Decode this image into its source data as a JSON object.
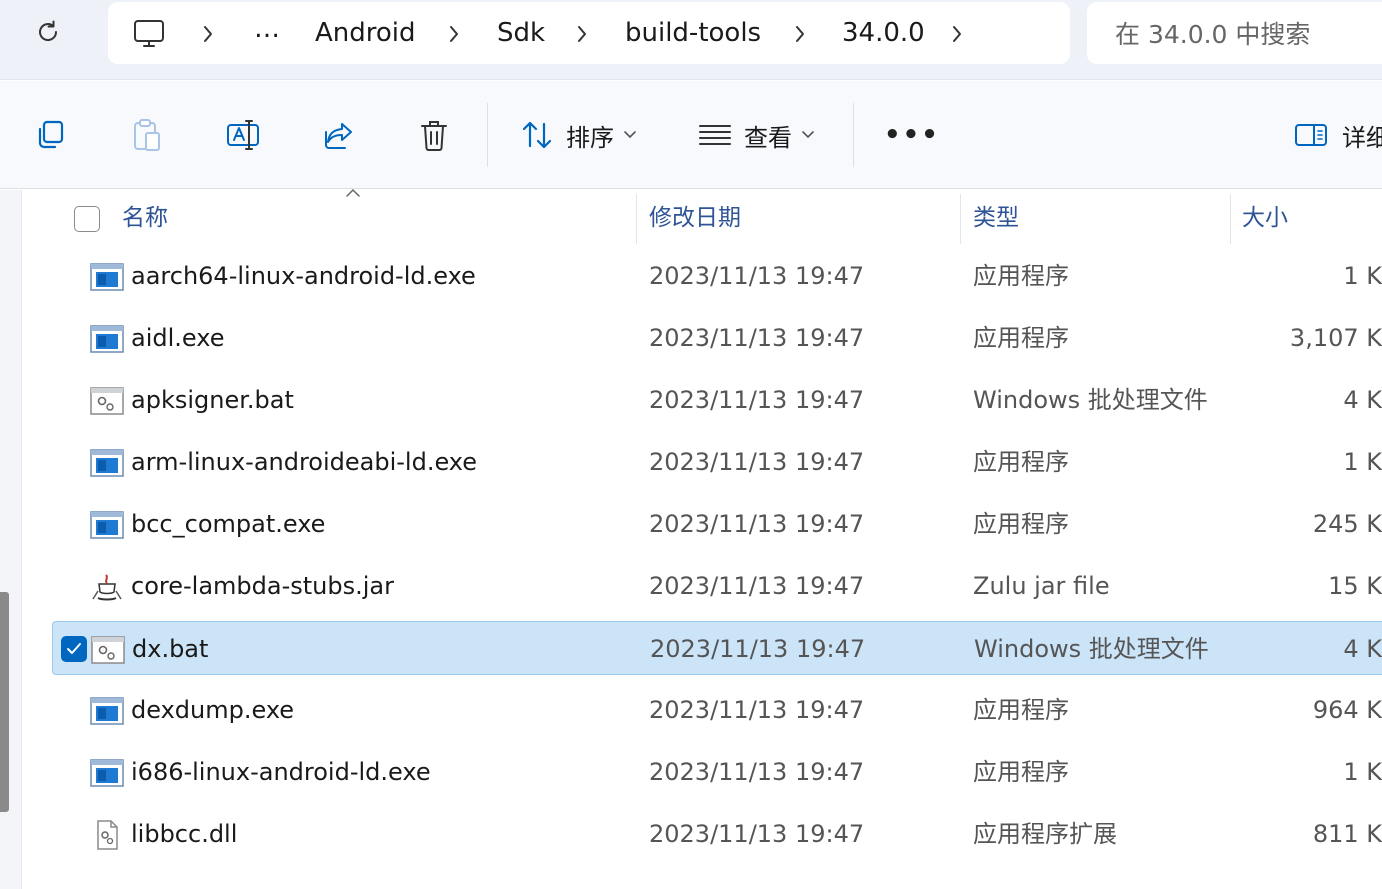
{
  "address_bar": {
    "refresh_icon": "refresh-icon",
    "computer_icon": "monitor-icon",
    "more_label": "…",
    "crumbs": [
      "Android",
      "Sdk",
      "build-tools",
      "34.0.0"
    ],
    "search_placeholder": "在 34.0.0 中搜索"
  },
  "toolbar": {
    "buttons": [
      "copy-icon",
      "paste-icon",
      "rename-icon",
      "share-icon",
      "delete-icon"
    ],
    "sort_label": "排序",
    "view_label": "查看",
    "more_label": "•••",
    "details_label": "详细"
  },
  "columns": {
    "name": "名称",
    "date": "修改日期",
    "type": "类型",
    "size": "大小"
  },
  "files": [
    {
      "name": "aarch64-linux-android-ld.exe",
      "date": "2023/11/13 19:47",
      "type": "应用程序",
      "size": "1 K",
      "icon": "exe-icon",
      "selected": false
    },
    {
      "name": "aidl.exe",
      "date": "2023/11/13 19:47",
      "type": "应用程序",
      "size": "3,107 K",
      "icon": "exe-icon",
      "selected": false
    },
    {
      "name": "apksigner.bat",
      "date": "2023/11/13 19:47",
      "type": "Windows 批处理文件",
      "size": "4 K",
      "icon": "bat-icon",
      "selected": false
    },
    {
      "name": "arm-linux-androideabi-ld.exe",
      "date": "2023/11/13 19:47",
      "type": "应用程序",
      "size": "1 K",
      "icon": "exe-icon",
      "selected": false
    },
    {
      "name": "bcc_compat.exe",
      "date": "2023/11/13 19:47",
      "type": "应用程序",
      "size": "245 K",
      "icon": "exe-icon",
      "selected": false
    },
    {
      "name": "core-lambda-stubs.jar",
      "date": "2023/11/13 19:47",
      "type": "Zulu jar file",
      "size": "15 K",
      "icon": "jar-icon",
      "selected": false
    },
    {
      "name": "dx.bat",
      "date": "2023/11/13 19:47",
      "type": "Windows 批处理文件",
      "size": "4 K",
      "icon": "bat-icon",
      "selected": true
    },
    {
      "name": "dexdump.exe",
      "date": "2023/11/13 19:47",
      "type": "应用程序",
      "size": "964 K",
      "icon": "exe-icon",
      "selected": false
    },
    {
      "name": "i686-linux-android-ld.exe",
      "date": "2023/11/13 19:47",
      "type": "应用程序",
      "size": "1 K",
      "icon": "exe-icon",
      "selected": false
    },
    {
      "name": "libbcc.dll",
      "date": "2023/11/13 19:47",
      "type": "应用程序扩展",
      "size": "811 K",
      "icon": "dll-icon",
      "selected": false
    }
  ],
  "colors": {
    "accent": "#0067c0",
    "selection_bg": "#cce4f7",
    "header_text": "#2f5496"
  }
}
